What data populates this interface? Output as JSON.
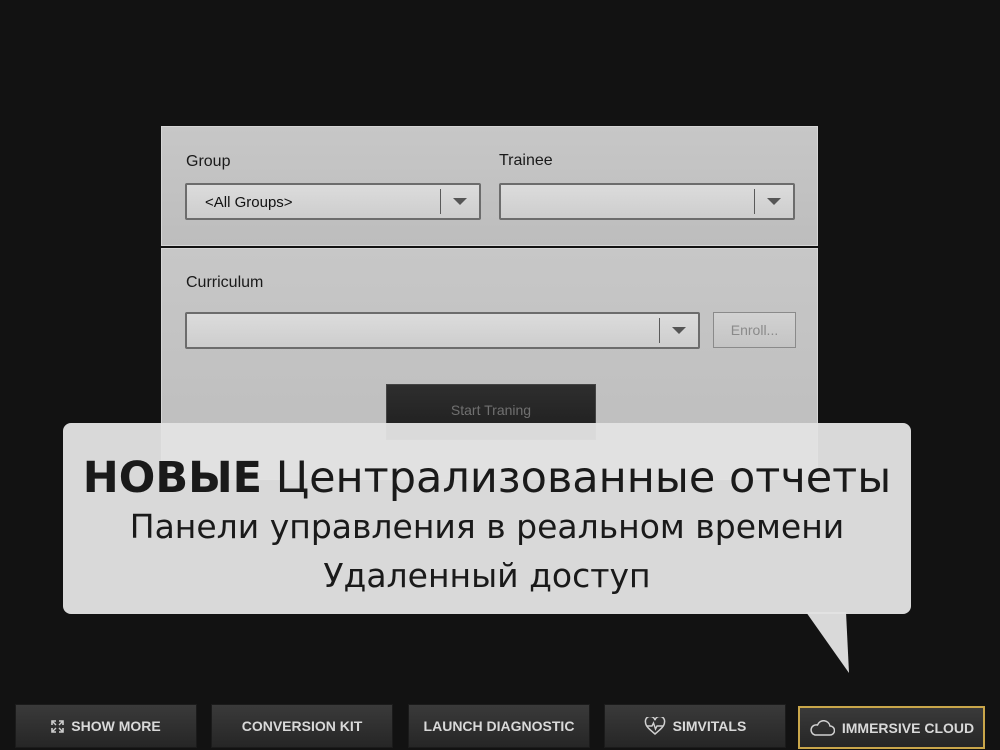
{
  "filters": {
    "group_label": "Group",
    "group_value": "<All Groups>",
    "trainee_label": "Trainee",
    "trainee_value": ""
  },
  "curriculum": {
    "label": "Curriculum",
    "value": "",
    "enroll_label": "Enroll...",
    "start_label": "Start Traning"
  },
  "callout": {
    "line1_bold": "НОВЫЕ",
    "line1_rest": " Централизованные отчеты",
    "line2": "Панели управления в реальном времени",
    "line3": "Удаленный доступ"
  },
  "bottom_bar": {
    "show_more": "SHOW MORE",
    "conversion_kit": "CONVERSION KIT",
    "launch_diagnostic": "LAUNCH DIAGNOSTIC",
    "simvitals": "SIMVITALS",
    "immersive_cloud": "IMMERSIVE CLOUD"
  },
  "colors": {
    "background": "#121212",
    "panel": "#c2c2c2",
    "accent_border": "#c9a64a"
  },
  "icons": [
    "expand-icon",
    "heart-pulse-icon",
    "cloud-icon",
    "chevron-down-icon"
  ]
}
